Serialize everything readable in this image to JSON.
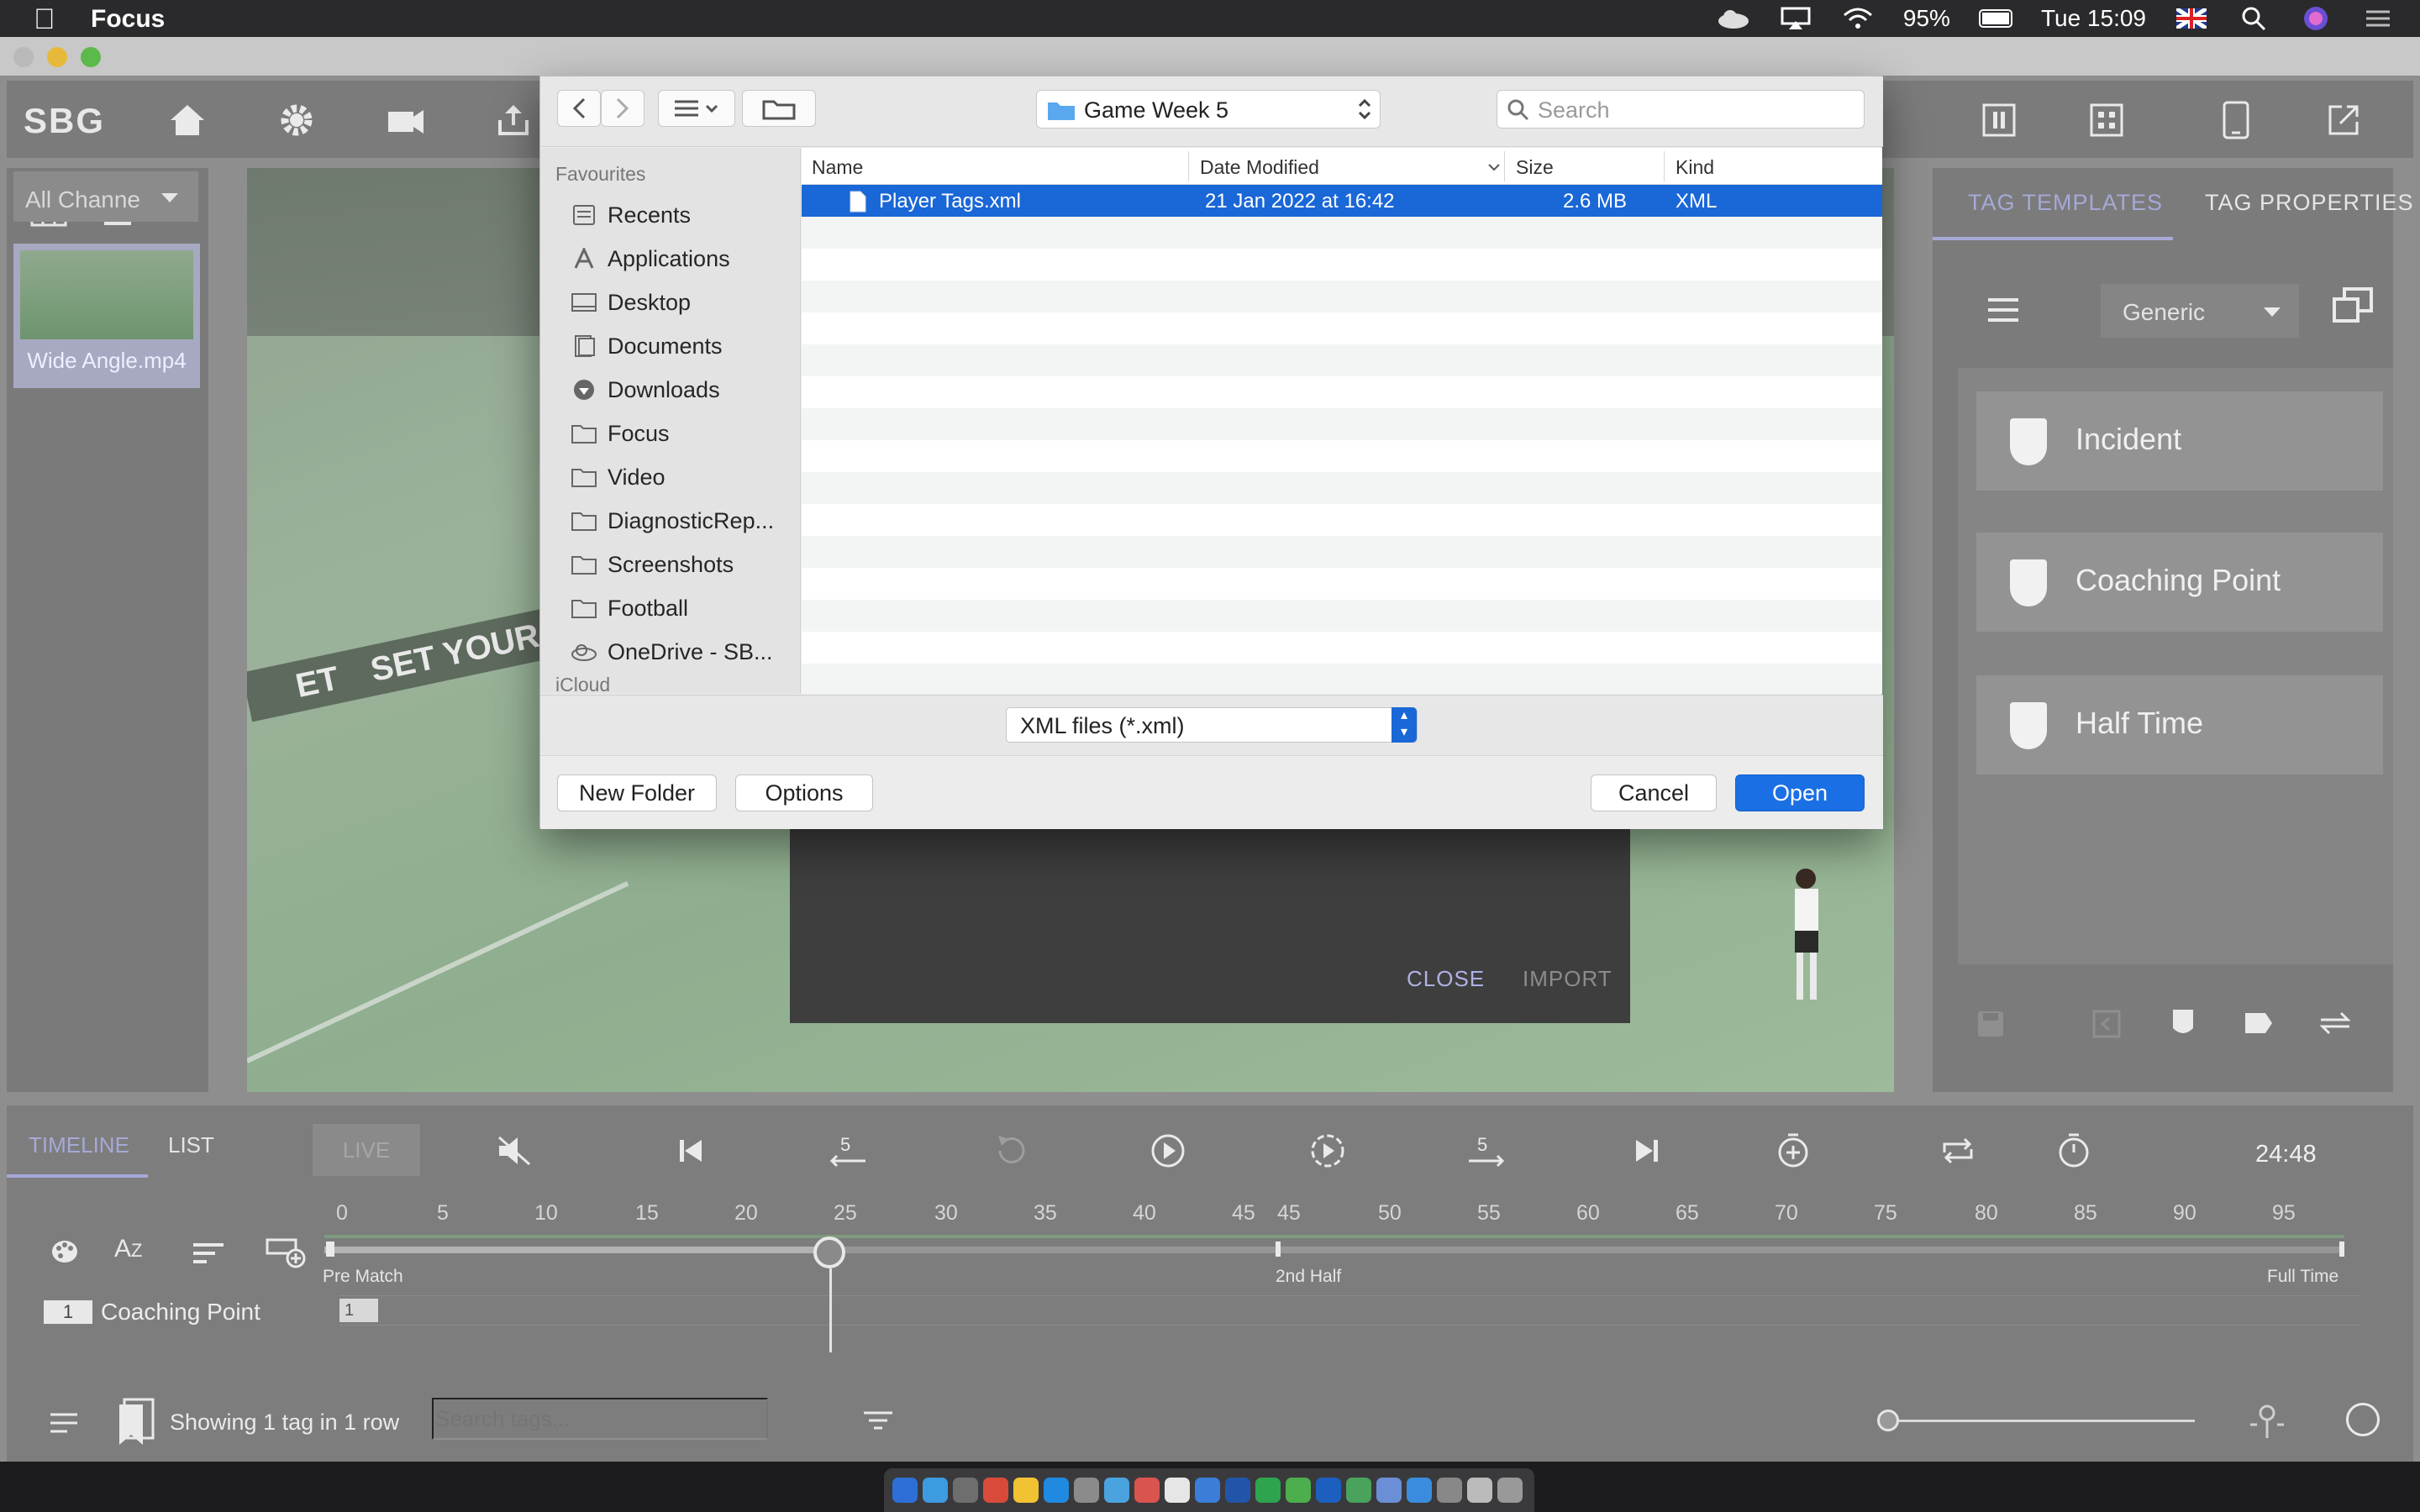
{
  "menubar": {
    "app_name": "Focus",
    "battery": "95%",
    "clock": "Tue 15:09"
  },
  "app": {
    "logo": "SBG",
    "channel_select": "All Channe",
    "thumbnail_label": "Wide Angle.mp4",
    "video_banner": "SET YOUR LIMITS",
    "video_banner_left": "ET"
  },
  "import_dialog": {
    "close_label": "CLOSE",
    "import_label": "IMPORT"
  },
  "right_panel": {
    "tabs": [
      "TAG TEMPLATES",
      "TAG PROPERTIES"
    ],
    "template_select": "Generic",
    "tags": [
      "Incident",
      "Coaching Point",
      "Half Time"
    ]
  },
  "bottom": {
    "tabs": [
      "TIMELINE",
      "LIST"
    ],
    "live_label": "LIVE",
    "time_readout": "24:48",
    "ticks": [
      "0",
      "5",
      "10",
      "15",
      "20",
      "25",
      "30",
      "35",
      "40",
      "45",
      "45",
      "50",
      "55",
      "60",
      "65",
      "70",
      "75",
      "80",
      "85",
      "90",
      "95"
    ],
    "segments": [
      "Pre Match",
      "2nd Half",
      "Full Time"
    ],
    "row_count": "1",
    "row_name": "Coaching Point",
    "row_mark": "1",
    "status": "Showing 1 tag in 1 row",
    "search_placeholder": "Search tags..."
  },
  "open_panel": {
    "folder": "Game Week 5",
    "search_placeholder": "Search",
    "sidebar_heading": "Favourites",
    "sidebar_items": [
      "Recents",
      "Applications",
      "Desktop",
      "Documents",
      "Downloads",
      "Focus",
      "Video",
      "DiagnosticRep...",
      "Screenshots",
      "Football",
      "OneDrive - SB..."
    ],
    "sidebar_cut": "iCloud",
    "columns": [
      "Name",
      "Date Modified",
      "Size",
      "Kind"
    ],
    "files": [
      {
        "name": "Player Tags.xml",
        "date": "21 Jan 2022 at 16:42",
        "size": "2.6 MB",
        "kind": "XML"
      }
    ],
    "filter": "XML files (*.xml)",
    "buttons": {
      "new_folder": "New Folder",
      "options": "Options",
      "cancel": "Cancel",
      "open": "Open"
    }
  }
}
